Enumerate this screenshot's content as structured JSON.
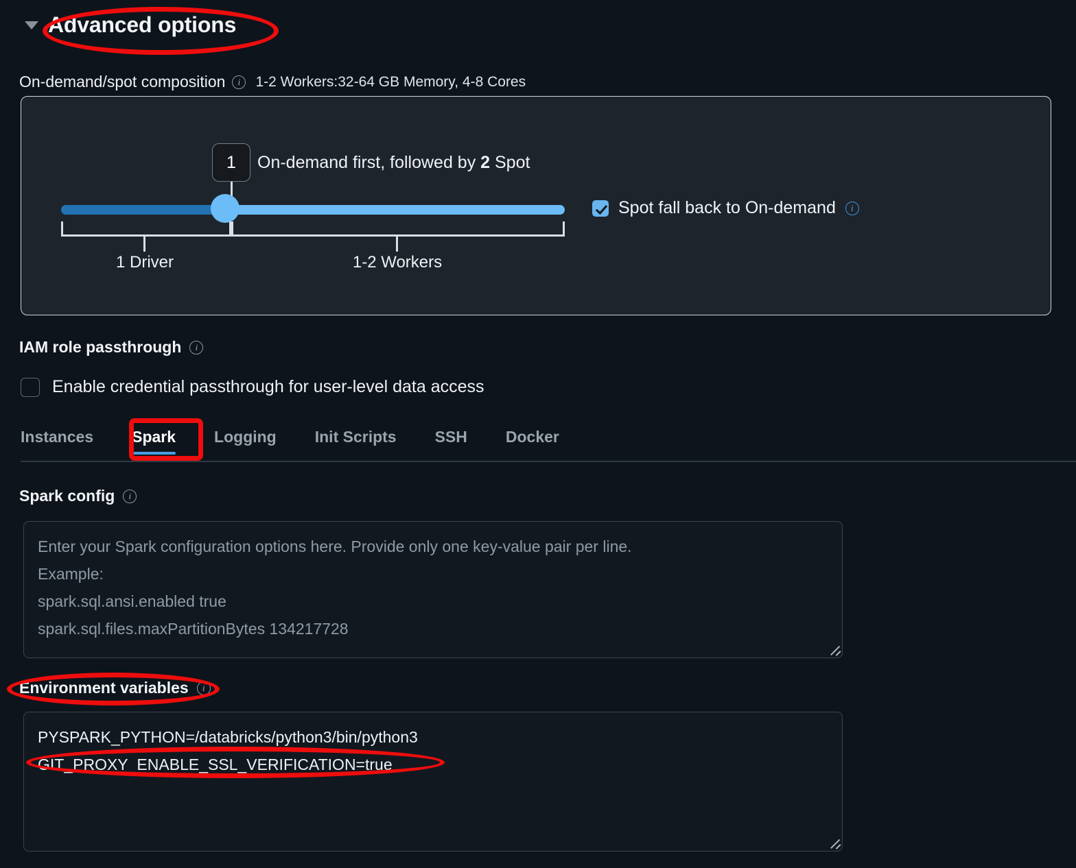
{
  "section": {
    "title": "Advanced options",
    "expanded_icon": "triangle-down-icon"
  },
  "composition": {
    "label": "On-demand/spot composition",
    "info_icon": "info-icon",
    "summary": "1-2 Workers:32-64 GB Memory, 4-8 Cores",
    "slider": {
      "badge_value": "1",
      "description_prefix": "On-demand first, followed by ",
      "description_value": "2",
      "description_suffix": " Spot",
      "left_bracket_label": "1 Driver",
      "right_bracket_label": "1-2 Workers",
      "track_left_color": "#2272b4",
      "track_right_color": "#6cbdf7",
      "thumb_color": "#6cbdf7"
    },
    "spot_fallback": {
      "label": "Spot fall back to On-demand",
      "checked": true,
      "info_icon": "info-icon"
    }
  },
  "iam": {
    "title": "IAM role passthrough",
    "info_icon": "info-icon",
    "checkbox_label": "Enable credential passthrough for user-level data access",
    "checked": false
  },
  "tabs": {
    "items": [
      {
        "label": "Instances",
        "active": false
      },
      {
        "label": "Spark",
        "active": true
      },
      {
        "label": "Logging",
        "active": false
      },
      {
        "label": "Init Scripts",
        "active": false
      },
      {
        "label": "SSH",
        "active": false
      },
      {
        "label": "Docker",
        "active": false
      }
    ],
    "active_underline_color": "#4a9ee4"
  },
  "spark_config": {
    "title": "Spark config",
    "info_icon": "info-icon",
    "value": "",
    "placeholder": "Enter your Spark configuration options here. Provide only one key-value pair per line.\nExample:\nspark.sql.ansi.enabled true\nspark.sql.files.maxPartitionBytes 134217728"
  },
  "environment_variables": {
    "title": "Environment variables",
    "info_icon": "info-icon",
    "value": "PYSPARK_PYTHON=/databricks/python3/bin/python3\nGIT_PROXY_ENABLE_SSL_VERIFICATION=true"
  },
  "annotations": {
    "color": "#ee0d0d",
    "items": [
      {
        "name": "advanced-options",
        "shape": "oval"
      },
      {
        "name": "spark-tab",
        "shape": "rect"
      },
      {
        "name": "environment-variables-title",
        "shape": "oval"
      },
      {
        "name": "git-proxy-env-line",
        "shape": "oval"
      }
    ]
  }
}
